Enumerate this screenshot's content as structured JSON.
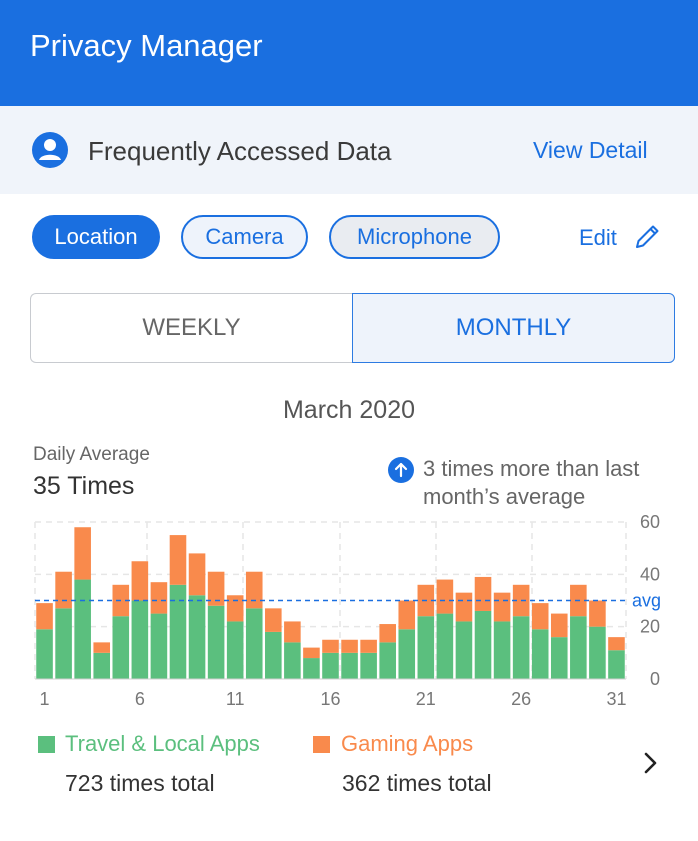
{
  "app": {
    "title": "Privacy Manager"
  },
  "section": {
    "title": "Frequently Accessed Data",
    "view_detail": "View Detail"
  },
  "chips": [
    {
      "label": "Location",
      "active": true
    },
    {
      "label": "Camera",
      "active": false
    },
    {
      "label": "Microphone",
      "active": false
    }
  ],
  "edit_label": "Edit",
  "segments": {
    "weekly": "WEEKLY",
    "monthly": "MONTHLY",
    "selected": "MONTHLY"
  },
  "summary": {
    "month": "March 2020",
    "daily_average_label": "Daily Average",
    "daily_average_value": "35 Times",
    "trend_text": "3 times more than last month’s average"
  },
  "colors": {
    "primary": "#1a6fe0",
    "travel": "#5bbf7e",
    "gaming": "#f98a4c"
  },
  "chart_data": {
    "type": "bar",
    "stacked": true,
    "x": [
      1,
      2,
      3,
      4,
      5,
      6,
      7,
      8,
      9,
      10,
      11,
      12,
      13,
      14,
      15,
      16,
      17,
      18,
      19,
      20,
      21,
      22,
      23,
      24,
      25,
      26,
      27,
      28,
      29,
      30,
      31
    ],
    "x_tick_labels": [
      "1",
      "6",
      "11",
      "16",
      "21",
      "26",
      "31"
    ],
    "x_ticks": [
      1,
      6,
      11,
      16,
      21,
      26,
      31
    ],
    "y_ticks": [
      0,
      20,
      40,
      60
    ],
    "ylim": [
      0,
      60
    ],
    "avg_value": 30,
    "avg_label": "avg",
    "grid": true,
    "series": [
      {
        "name": "Travel & Local Apps",
        "color": "#5bbf7e",
        "values": [
          19,
          27,
          38,
          10,
          24,
          30,
          25,
          36,
          32,
          28,
          22,
          27,
          18,
          14,
          8,
          10,
          10,
          10,
          14,
          19,
          24,
          25,
          22,
          26,
          22,
          24,
          19,
          16,
          24,
          20,
          11
        ]
      },
      {
        "name": "Gaming Apps",
        "color": "#f98a4c",
        "values": [
          10,
          14,
          20,
          4,
          12,
          15,
          12,
          19,
          16,
          13,
          10,
          14,
          9,
          8,
          4,
          5,
          5,
          5,
          7,
          11,
          12,
          13,
          11,
          13,
          11,
          12,
          10,
          9,
          12,
          10,
          5
        ]
      }
    ],
    "totals": [
      "723 times total",
      "362 times total"
    ]
  }
}
